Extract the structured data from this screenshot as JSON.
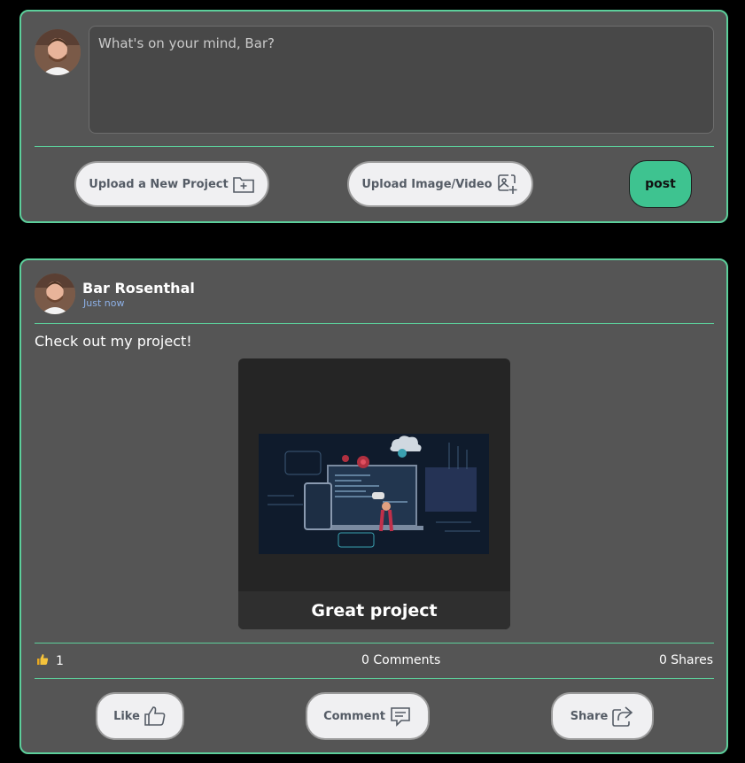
{
  "composer": {
    "placeholder": "What's on your mind, Bar?",
    "upload_project_label": "Upload a New Project",
    "upload_media_label": "Upload Image/Video",
    "post_label": "post"
  },
  "post": {
    "author": "Bar Rosenthal",
    "time": "Just now",
    "text": "Check out my project!",
    "project_title": "Great project",
    "likes": "1",
    "comments_label": "0 Comments",
    "shares_label": "0 Shares",
    "actions": {
      "like_label": "Like",
      "comment_label": "Comment",
      "share_label": "Share"
    }
  },
  "colors": {
    "accent": "#5ccf9b",
    "post_button": "#3ec390",
    "card_bg": "#555555",
    "page_bg": "#000000",
    "time_text": "#8db0e6"
  },
  "icons": {
    "upload_project": "folder-plus-icon",
    "upload_media": "image-plus-icon",
    "like_emoji": "thumbs-up-emoji-icon",
    "like": "thumbs-up-icon",
    "comment": "comment-icon",
    "share": "share-icon"
  }
}
